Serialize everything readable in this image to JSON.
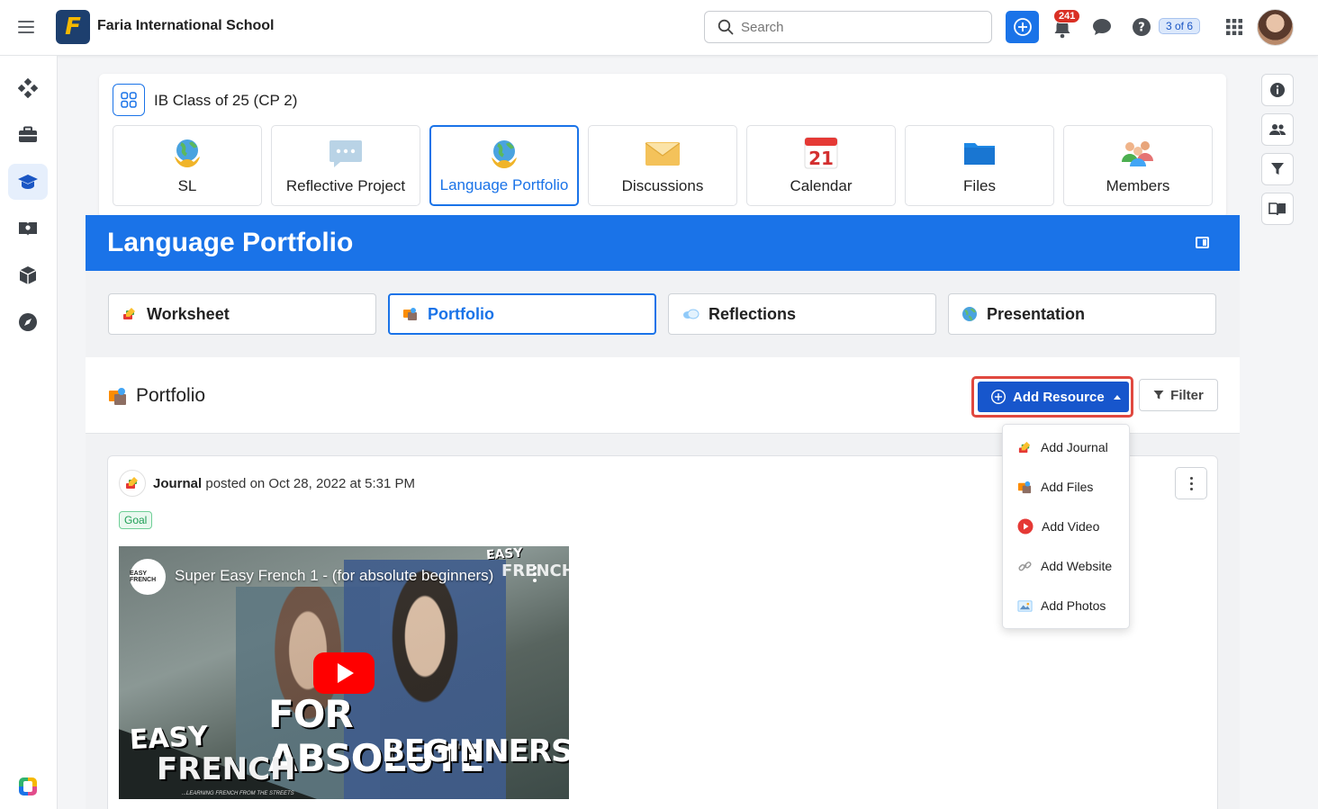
{
  "header": {
    "school_name": "Faria International School",
    "logo_letter": "F",
    "search_placeholder": "Search",
    "notification_count": "241",
    "guide_progress": "3 of 6"
  },
  "class": {
    "title": "IB Class of 25 (CP 2)",
    "tiles": [
      {
        "label": "SL",
        "icon": "globe-hands-icon"
      },
      {
        "label": "Reflective Project",
        "icon": "speech-bubble-icon"
      },
      {
        "label": "Language Portfolio",
        "icon": "globe-hands-icon",
        "active": true
      },
      {
        "label": "Discussions",
        "icon": "envelope-icon"
      },
      {
        "label": "Calendar",
        "icon": "calendar-icon",
        "day": "21"
      },
      {
        "label": "Files",
        "icon": "folder-icon"
      },
      {
        "label": "Members",
        "icon": "people-icon"
      }
    ]
  },
  "section": {
    "title": "Language Portfolio",
    "subtabs": [
      {
        "label": "Worksheet",
        "icon": "pencil-icon"
      },
      {
        "label": "Portfolio",
        "icon": "portfolio-icon",
        "active": true
      },
      {
        "label": "Reflections",
        "icon": "cloud-icon"
      },
      {
        "label": "Presentation",
        "icon": "globe-icon"
      }
    ]
  },
  "portfolio": {
    "title": "Portfolio",
    "add_resource_label": "Add Resource",
    "filter_label": "Filter",
    "menu": [
      {
        "label": "Add Journal",
        "icon": "journal-icon"
      },
      {
        "label": "Add Files",
        "icon": "files-icon"
      },
      {
        "label": "Add Video",
        "icon": "video-icon"
      },
      {
        "label": "Add Website",
        "icon": "link-icon"
      },
      {
        "label": "Add Photos",
        "icon": "photo-icon"
      }
    ]
  },
  "post": {
    "type": "Journal",
    "posted_text": "posted on Oct 28, 2022 at 5:31 PM",
    "tag": "Goal",
    "video": {
      "title": "Super Easy French 1 - (for absolute beginners)",
      "channel": "EASY FRENCH",
      "overlay_line1": "FOR ABSOLUTE",
      "overlay_line2": "BEGINNERS",
      "brand_easy": "EASY",
      "brand_french": "FRENCH",
      "corner_easy": "EASY",
      "corner_french": "FRENCH",
      "tagline": "...LEARNING FRENCH FROM THE STREETS"
    }
  },
  "colors": {
    "accent": "#1a73e8",
    "add_resource": "#1756cc",
    "highlight": "#e0483f",
    "badge": "#d93025"
  }
}
